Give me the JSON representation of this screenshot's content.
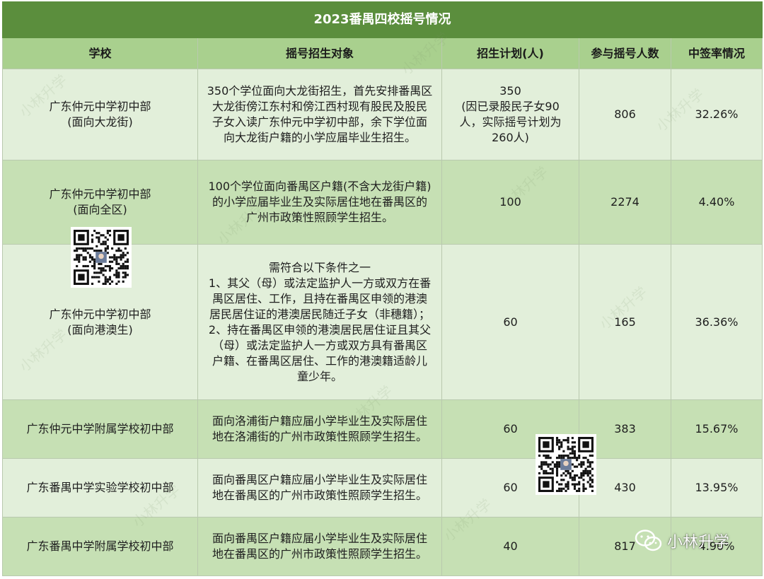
{
  "title": "2023番禺四校摇号情况",
  "headers": [
    "学校",
    "摇号招生对象",
    "招生计划(人)",
    "参与摇号人数",
    "中签率情况"
  ],
  "rows": [
    {
      "school": [
        "广东仲元中学初中部",
        "(面向大龙街)"
      ],
      "target": [
        "350个学位面向大龙街招生，首先安排番禺区",
        "大龙街傍江东村和傍江西村现有股民及股民",
        "子女入读广东仲元中学初中部，余下学位面",
        "向大龙街户籍的小学应届毕业生招生。"
      ],
      "plan": [
        "350",
        "(因已录股民子女90",
        "人，实际摇号计划为",
        "260人)"
      ],
      "participants": "806",
      "rate": "32.26%"
    },
    {
      "school": [
        "广东仲元中学初中部",
        "(面向全区)"
      ],
      "target": [
        "100个学位面向番禺区户籍(不含大龙街户籍)",
        "的小学应届毕业生及实际居住地在番禺区的",
        "广州市政策性照顾学生招生。"
      ],
      "plan": [
        "100"
      ],
      "participants": "2274",
      "rate": "4.40%"
    },
    {
      "school": [
        "广东仲元中学初中部",
        "(面向港澳生)"
      ],
      "target": [
        "需符合以下条件之一",
        "1、其父（母）或法定监护人一方或双方在番",
        "禺区居住、工作，且持在番禺区申领的港澳",
        "居民居住证的港澳居民随迁子女（非穗籍）；",
        "2、持在番禺区申领的港澳居民居住证且其父",
        "（母）或法定监护人一方或双方具有番禺区",
        "户籍、在番禺区居住、工作的港澳籍适龄儿",
        "童少年。"
      ],
      "plan": [
        "60"
      ],
      "participants": "165",
      "rate": "36.36%"
    },
    {
      "school": [
        "广东仲元中学附属学校初中部"
      ],
      "target": [
        "面向洛浦街户籍应届小学毕业生及实际居住",
        "地在洛浦街的广州市政策性照顾学生招生。"
      ],
      "plan": [
        "60"
      ],
      "participants": "383",
      "rate": "15.67%"
    },
    {
      "school": [
        "广东番禺中学实验学校初中部"
      ],
      "target": [
        "面向番禺区户籍应届小学毕业生及实际居住",
        "地在番禺区的广州市政策性照顾学生招生。"
      ],
      "plan": [
        "60"
      ],
      "participants": "430",
      "rate": "13.95%"
    },
    {
      "school": [
        "广东番禺中学附属学校初中部"
      ],
      "target": [
        "面向番禺区户籍应届小学毕业生及实际居住",
        "地在番禺区的广州市政策性照顾学生招生。"
      ],
      "plan": [
        "40"
      ],
      "participants": "817",
      "rate": "4.90%"
    }
  ],
  "watermark": "小林升学",
  "logo_text": "小林升学",
  "icons": [
    "qr-code-icon",
    "wechat-icon"
  ],
  "colors": {
    "title_bg": "#5b8e3d",
    "header_bg": "#a9d08e",
    "row_light": "#e2efda",
    "row_mid": "#c6e0b4"
  }
}
